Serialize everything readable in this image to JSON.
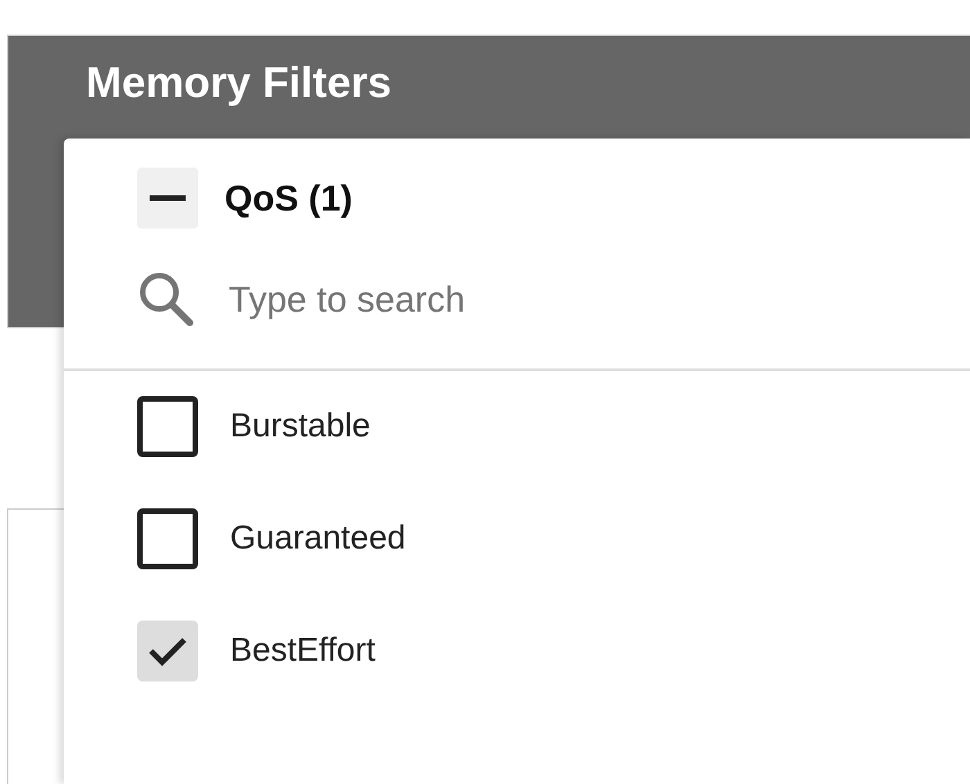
{
  "header": {
    "title": "Memory Filters"
  },
  "filter_menu": {
    "group": {
      "label": "QoS (1)",
      "expanded": true
    },
    "search": {
      "placeholder": "Type to search"
    },
    "options": [
      {
        "label": "Burstable",
        "checked": false
      },
      {
        "label": "Guaranteed",
        "checked": false
      },
      {
        "label": "BestEffort",
        "checked": true
      }
    ]
  }
}
